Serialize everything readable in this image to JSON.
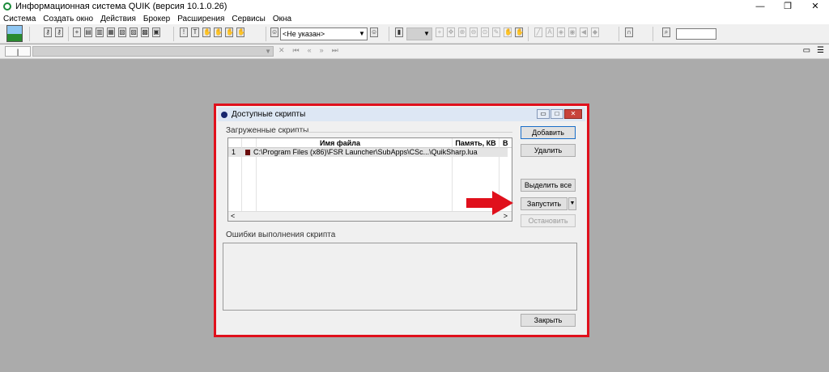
{
  "window": {
    "title": "Информационная система QUIK (версия 10.1.0.26)",
    "controls": [
      "—",
      "❐",
      "✕"
    ]
  },
  "menu": [
    "Система",
    "Создать окно",
    "Действия",
    "Брокер",
    "Расширения",
    "Сервисы",
    "Окна"
  ],
  "toolbar": {
    "account_select": "<Не указан>"
  },
  "toolbar2": {
    "left_field": "|",
    "nav": [
      "⏮",
      "«",
      "»",
      "⏭"
    ]
  },
  "dialog": {
    "title": "Доступные скрипты",
    "loaded_group": "Загруженные скрипты",
    "table": {
      "columns": [
        "Имя файла",
        "Память, КВ",
        "В"
      ],
      "rows": [
        {
          "num": "1",
          "file": "C:\\Program Files (x86)\\FSR Launcher\\SubApps\\CSc...\\QuikSharp.lua"
        }
      ]
    },
    "buttons": {
      "add": "Добавить",
      "remove": "Удалить",
      "select_all": "Выделить все",
      "run": "Запустить",
      "stop": "Остановить",
      "close": "Закрыть"
    },
    "errors_group": "Ошибки выполнения скрипта"
  },
  "colors": {
    "highlight_frame": "#e0101c",
    "arrow": "#e0101c"
  }
}
